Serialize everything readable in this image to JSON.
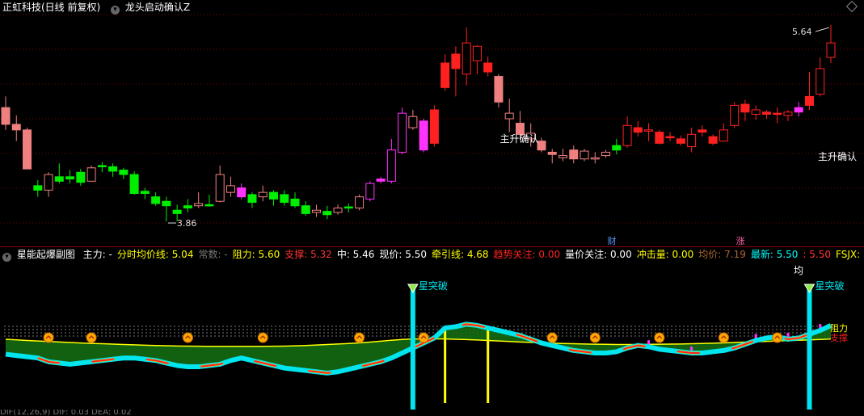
{
  "header": {
    "stock": "正虹科技(日线 前复权)",
    "indicator": "龙头启动确认Z",
    "chevron": "▾"
  },
  "main_chart": {
    "high_label": "5.64",
    "low_label": "3.86",
    "signal_label": "主升确认",
    "right_label": "主升确认",
    "event_cai": "财",
    "event_zhang": "涨"
  },
  "sub_header": {
    "title": "星能起爆副图",
    "items": [
      {
        "text": "主力: -",
        "color": "#ffffff"
      },
      {
        "text": "分时均价线: 5.04",
        "color": "#ffff00"
      },
      {
        "text": "常数: -",
        "color": "#777777"
      },
      {
        "text": "阻力: 5.60",
        "color": "#ffff00"
      },
      {
        "text": "支撑: 5.32",
        "color": "#ff3333"
      },
      {
        "text": "中: 5.46",
        "color": "#ffffff"
      },
      {
        "text": "现价: 5.50",
        "color": "#ffffff"
      },
      {
        "text": "牵引线: 4.68",
        "color": "#ffff00"
      },
      {
        "text": "趋势关注: 0.00",
        "color": "#ff2222"
      },
      {
        "text": "量价关注: 0.00",
        "color": "#ffffff"
      },
      {
        "text": "冲击量: 0.00",
        "color": "#ffff00"
      },
      {
        "text": "均价: 7.19",
        "color": "#aa6633"
      },
      {
        "text": "最新: 5.50",
        "color": "#00ffff"
      },
      {
        "text": ": 5.50",
        "color": "#ff3333"
      },
      {
        "text": "FSJX: 5.50",
        "color": "#ffff00"
      }
    ]
  },
  "sub_chart": {
    "burst_label": "星突破",
    "jun_label": "均",
    "zuli_label": "阻力",
    "zhicheng_label": "支撑"
  },
  "footer": {
    "text": "DIF(12,26,9) DIF: 0.03 DEA: 0.02"
  },
  "colors": {
    "up_red": "#ff2020",
    "up_pink": "#f08080",
    "down_green": "#00ee00",
    "magenta": "#ff33ff",
    "cyan": "#00e5ee",
    "yellow": "#ffff00",
    "grid_red": "#7a0000"
  },
  "chart_data": {
    "type": "candlestick",
    "ylim": [
      3.75,
      5.72
    ],
    "candles": [
      {
        "o": 4.9,
        "h": 5.0,
        "l": 4.7,
        "c": 4.75,
        "t": "pink"
      },
      {
        "o": 4.75,
        "h": 4.83,
        "l": 4.6,
        "c": 4.7,
        "t": "pink"
      },
      {
        "o": 4.7,
        "h": 4.72,
        "l": 4.35,
        "c": 4.35,
        "t": "pink"
      },
      {
        "o": 4.2,
        "h": 4.25,
        "l": 4.1,
        "c": 4.16,
        "t": "green"
      },
      {
        "o": 4.16,
        "h": 4.32,
        "l": 4.1,
        "c": 4.3,
        "t": "pinkhollow"
      },
      {
        "o": 4.28,
        "h": 4.4,
        "l": 4.22,
        "c": 4.24,
        "t": "green"
      },
      {
        "o": 4.26,
        "h": 4.34,
        "l": 4.22,
        "c": 4.28,
        "t": "green"
      },
      {
        "o": 4.32,
        "h": 4.35,
        "l": 4.2,
        "c": 4.23,
        "t": "green"
      },
      {
        "o": 4.24,
        "h": 4.38,
        "l": 4.24,
        "c": 4.36,
        "t": "pinkhollow"
      },
      {
        "o": 4.38,
        "h": 4.41,
        "l": 4.32,
        "c": 4.38,
        "t": "green"
      },
      {
        "o": 4.37,
        "h": 4.4,
        "l": 4.28,
        "c": 4.33,
        "t": "green"
      },
      {
        "o": 4.34,
        "h": 4.36,
        "l": 4.26,
        "c": 4.3,
        "t": "green"
      },
      {
        "o": 4.3,
        "h": 4.33,
        "l": 4.12,
        "c": 4.13,
        "t": "green"
      },
      {
        "o": 4.15,
        "h": 4.18,
        "l": 4.08,
        "c": 4.13,
        "t": "green"
      },
      {
        "o": 4.1,
        "h": 4.14,
        "l": 4.02,
        "c": 4.04,
        "t": "green"
      },
      {
        "o": 4.06,
        "h": 4.1,
        "l": 3.88,
        "c": 4.02,
        "t": "green"
      },
      {
        "o": 3.98,
        "h": 4.03,
        "l": 3.88,
        "c": 3.95,
        "t": "green"
      },
      {
        "o": 4.02,
        "h": 4.08,
        "l": 3.96,
        "c": 4.0,
        "t": "green"
      },
      {
        "o": 4.04,
        "h": 4.14,
        "l": 4.0,
        "c": 4.02,
        "t": "pinkhollow"
      },
      {
        "o": 4.03,
        "h": 4.12,
        "l": 4.01,
        "c": 4.02,
        "t": "green"
      },
      {
        "o": 4.06,
        "h": 4.38,
        "l": 4.05,
        "c": 4.3,
        "t": "pinkhollow"
      },
      {
        "o": 4.2,
        "h": 4.28,
        "l": 4.1,
        "c": 4.14,
        "t": "pinkhollow"
      },
      {
        "o": 4.1,
        "h": 4.22,
        "l": 4.08,
        "c": 4.18,
        "t": "magenta"
      },
      {
        "o": 4.12,
        "h": 4.14,
        "l": 4.0,
        "c": 4.05,
        "t": "green"
      },
      {
        "o": 4.1,
        "h": 4.2,
        "l": 4.06,
        "c": 4.14,
        "t": "pinkhollow"
      },
      {
        "o": 4.14,
        "h": 4.16,
        "l": 4.02,
        "c": 4.08,
        "t": "green"
      },
      {
        "o": 4.12,
        "h": 4.16,
        "l": 4.02,
        "c": 4.05,
        "t": "green"
      },
      {
        "o": 4.08,
        "h": 4.14,
        "l": 4.0,
        "c": 4.02,
        "t": "green"
      },
      {
        "o": 4.02,
        "h": 4.06,
        "l": 3.93,
        "c": 3.95,
        "t": "green"
      },
      {
        "o": 3.98,
        "h": 4.03,
        "l": 3.92,
        "c": 3.96,
        "t": "pinkhollow"
      },
      {
        "o": 3.97,
        "h": 4.02,
        "l": 3.9,
        "c": 3.94,
        "t": "green"
      },
      {
        "o": 3.96,
        "h": 4.03,
        "l": 3.94,
        "c": 4.0,
        "t": "pinkhollow"
      },
      {
        "o": 4.01,
        "h": 4.04,
        "l": 3.96,
        "c": 4.0,
        "t": "green"
      },
      {
        "o": 4.0,
        "h": 4.12,
        "l": 3.98,
        "c": 4.1,
        "t": "pinkhollow"
      },
      {
        "o": 4.08,
        "h": 4.24,
        "l": 4.06,
        "c": 4.22,
        "t": "maghollow"
      },
      {
        "o": 4.24,
        "h": 4.28,
        "l": 4.22,
        "c": 4.26,
        "t": "magenta"
      },
      {
        "o": 4.24,
        "h": 4.62,
        "l": 4.22,
        "c": 4.52,
        "t": "maghollow"
      },
      {
        "o": 4.5,
        "h": 4.9,
        "l": 4.48,
        "c": 4.85,
        "t": "maghollow"
      },
      {
        "o": 4.72,
        "h": 4.88,
        "l": 4.7,
        "c": 4.82,
        "t": "pinkhollow"
      },
      {
        "o": 4.78,
        "h": 4.8,
        "l": 4.5,
        "c": 4.52,
        "t": "magenta"
      },
      {
        "o": 4.58,
        "h": 4.92,
        "l": 4.55,
        "c": 4.88,
        "t": "red"
      },
      {
        "o": 5.08,
        "h": 5.38,
        "l": 5.05,
        "c": 5.3,
        "t": "red"
      },
      {
        "o": 5.25,
        "h": 5.45,
        "l": 5.0,
        "c": 5.38,
        "t": "red"
      },
      {
        "o": 5.2,
        "h": 5.62,
        "l": 5.1,
        "c": 5.48,
        "t": "redhollow"
      },
      {
        "o": 5.32,
        "h": 5.46,
        "l": 5.2,
        "c": 5.45,
        "t": "redhollow"
      },
      {
        "o": 5.3,
        "h": 5.36,
        "l": 5.18,
        "c": 5.22,
        "t": "red"
      },
      {
        "o": 5.18,
        "h": 5.2,
        "l": 4.9,
        "c": 4.95,
        "t": "pink"
      },
      {
        "o": 4.85,
        "h": 4.98,
        "l": 4.68,
        "c": 4.8,
        "t": "pinkhollow"
      },
      {
        "o": 4.76,
        "h": 4.87,
        "l": 4.62,
        "c": 4.66,
        "t": "pink"
      },
      {
        "o": 4.67,
        "h": 4.76,
        "l": 4.55,
        "c": 4.62,
        "t": "pinkhollow"
      },
      {
        "o": 4.6,
        "h": 4.63,
        "l": 4.5,
        "c": 4.52,
        "t": "pink"
      },
      {
        "o": 4.5,
        "h": 4.53,
        "l": 4.4,
        "c": 4.48,
        "t": "pink"
      },
      {
        "o": 4.45,
        "h": 4.53,
        "l": 4.42,
        "c": 4.47,
        "t": "pinkhollow"
      },
      {
        "o": 4.52,
        "h": 4.56,
        "l": 4.4,
        "c": 4.44,
        "t": "pink"
      },
      {
        "o": 4.44,
        "h": 4.53,
        "l": 4.42,
        "c": 4.51,
        "t": "pinkhollow"
      },
      {
        "o": 4.44,
        "h": 4.5,
        "l": 4.4,
        "c": 4.45,
        "t": "pinkhollow"
      },
      {
        "o": 4.47,
        "h": 4.52,
        "l": 4.45,
        "c": 4.5,
        "t": "pinkhollow"
      },
      {
        "o": 4.52,
        "h": 4.62,
        "l": 4.48,
        "c": 4.56,
        "t": "green"
      },
      {
        "o": 4.56,
        "h": 4.82,
        "l": 4.54,
        "c": 4.74,
        "t": "redhollow"
      },
      {
        "o": 4.72,
        "h": 4.78,
        "l": 4.64,
        "c": 4.68,
        "t": "red"
      },
      {
        "o": 4.7,
        "h": 4.76,
        "l": 4.6,
        "c": 4.69,
        "t": "redhollow"
      },
      {
        "o": 4.68,
        "h": 4.7,
        "l": 4.57,
        "c": 4.58,
        "t": "red"
      },
      {
        "o": 4.64,
        "h": 4.68,
        "l": 4.6,
        "c": 4.63,
        "t": "red"
      },
      {
        "o": 4.62,
        "h": 4.65,
        "l": 4.56,
        "c": 4.58,
        "t": "red"
      },
      {
        "o": 4.55,
        "h": 4.72,
        "l": 4.5,
        "c": 4.66,
        "t": "redhollow"
      },
      {
        "o": 4.68,
        "h": 4.74,
        "l": 4.64,
        "c": 4.7,
        "t": "red"
      },
      {
        "o": 4.64,
        "h": 4.66,
        "l": 4.56,
        "c": 4.58,
        "t": "red"
      },
      {
        "o": 4.6,
        "h": 4.76,
        "l": 4.6,
        "c": 4.7,
        "t": "redhollow"
      },
      {
        "o": 4.74,
        "h": 4.95,
        "l": 4.72,
        "c": 4.92,
        "t": "redhollow"
      },
      {
        "o": 4.93,
        "h": 4.97,
        "l": 4.78,
        "c": 4.86,
        "t": "red"
      },
      {
        "o": 4.84,
        "h": 4.92,
        "l": 4.79,
        "c": 4.88,
        "t": "redhollow"
      },
      {
        "o": 4.86,
        "h": 4.88,
        "l": 4.8,
        "c": 4.84,
        "t": "red"
      },
      {
        "o": 4.85,
        "h": 4.9,
        "l": 4.76,
        "c": 4.84,
        "t": "red"
      },
      {
        "o": 4.83,
        "h": 4.88,
        "l": 4.78,
        "c": 4.86,
        "t": "redhollow"
      },
      {
        "o": 4.86,
        "h": 4.95,
        "l": 4.82,
        "c": 4.9,
        "t": "magenta"
      },
      {
        "o": 4.92,
        "h": 5.22,
        "l": 4.88,
        "c": 5.0,
        "t": "red"
      },
      {
        "o": 5.02,
        "h": 5.35,
        "l": 5.0,
        "c": 5.25,
        "t": "redhollow"
      },
      {
        "o": 5.35,
        "h": 5.64,
        "l": 5.3,
        "c": 5.48,
        "t": "redhollow"
      }
    ],
    "sub_ylim": [
      0,
      100
    ],
    "yellow_line": [
      51,
      50.5,
      50,
      49.6,
      49.2,
      48.8,
      48.4,
      48,
      47.7,
      47.4,
      47.1,
      46.8,
      46.5,
      46.2,
      46,
      45.8,
      45.6,
      45.5,
      45.4,
      45.3,
      45.3,
      45.3,
      45.3,
      45.3,
      45.3,
      45.4,
      45.5,
      45.7,
      46,
      46.4,
      46.8,
      47.2,
      47.6,
      48.1,
      48.7,
      49.4,
      50.2,
      50.8,
      51.2,
      51.3,
      51.3,
      51.2,
      51,
      50.7,
      50.4,
      50,
      49.6,
      49.2,
      48.8,
      48.5,
      48.2,
      47.9,
      47.6,
      47.4,
      47.2,
      47,
      46.9,
      46.8,
      46.8,
      46.8,
      46.9,
      47,
      47.1,
      47.2,
      47.4,
      47.6,
      47.8,
      48.1,
      48.4,
      48.7,
      49,
      49.3,
      49.6,
      49.9,
      50.2,
      50.5,
      50.8,
      51.2
    ],
    "cyan_line": [
      39,
      38,
      37,
      36,
      33,
      32,
      31,
      32,
      33,
      34,
      35,
      36,
      36,
      35,
      34,
      32,
      30,
      29,
      29,
      30,
      31,
      34,
      36,
      34,
      32,
      30,
      28,
      27,
      26,
      25,
      24,
      25,
      27,
      29,
      31,
      33,
      36,
      40,
      44,
      48,
      52,
      60,
      61,
      63,
      62,
      60,
      58,
      56,
      54,
      51,
      48,
      46,
      44,
      42,
      41,
      40,
      40,
      41,
      44,
      46,
      45,
      43,
      42,
      41,
      40,
      40,
      41,
      42,
      44,
      47,
      50,
      52,
      53,
      51,
      52,
      55,
      58,
      62
    ],
    "red_line": [
      39,
      38,
      37,
      36,
      33,
      32,
      31,
      32,
      33,
      34,
      35,
      36,
      36,
      35,
      34,
      32,
      30,
      29,
      29,
      30,
      31,
      34,
      36,
      34,
      32,
      30,
      28,
      27,
      26,
      25,
      24,
      25,
      27,
      29,
      31,
      33,
      36,
      40,
      44,
      48,
      52,
      60,
      61,
      63,
      62,
      60,
      58,
      56,
      54,
      51,
      48,
      46,
      44,
      42,
      41,
      40,
      40,
      41,
      44,
      46,
      45,
      43,
      42,
      41,
      40,
      40,
      41,
      42,
      44,
      47,
      50,
      52,
      53,
      51,
      52,
      55,
      58,
      62
    ]
  }
}
